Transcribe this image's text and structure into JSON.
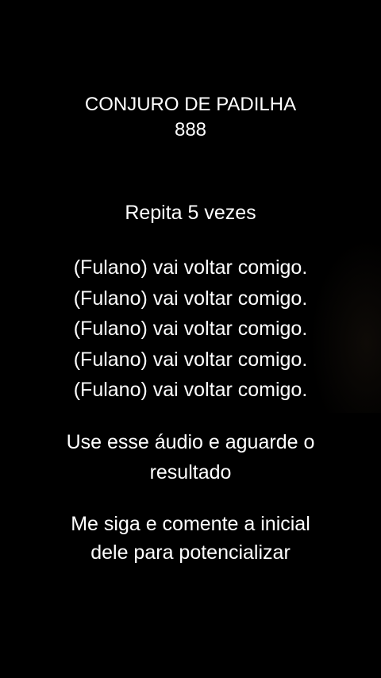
{
  "title": {
    "line1": "CONJURO DE PADILHA",
    "line2": "888"
  },
  "instruction": "Repita 5 vezes",
  "chant": [
    "(Fulano) vai voltar comigo.",
    "(Fulano) vai voltar comigo.",
    "(Fulano) vai voltar comigo.",
    "(Fulano) vai voltar comigo.",
    "(Fulano) vai voltar comigo."
  ],
  "note_audio": {
    "line1": "Use esse áudio e aguarde o",
    "line2": "resultado"
  },
  "note_follow": {
    "line1": "Me siga e comente a inicial",
    "line2": "dele para potencializar"
  },
  "colors": {
    "background": "#000000",
    "text": "#ffffff"
  }
}
